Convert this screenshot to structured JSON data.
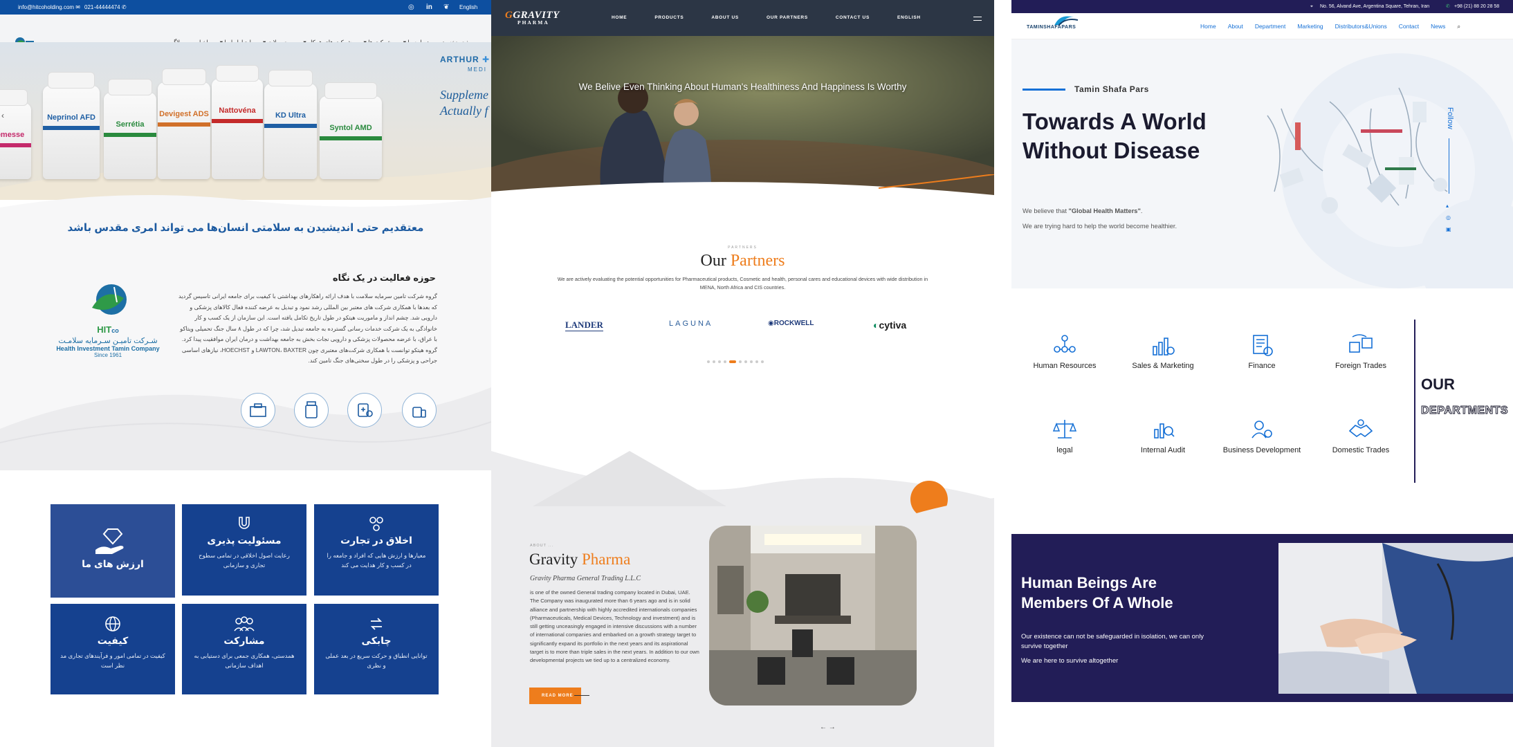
{
  "panel1": {
    "topbar": {
      "email": "info@hitcoholding.com",
      "phone": "021-44444474",
      "lang": "English"
    },
    "nav": [
      "صفحه نخست",
      "درباره ما",
      "شرکت ها",
      "شرکت های همکار",
      "محصولات",
      "ارتباط با ما",
      "اخبار",
      "وبلاگ"
    ],
    "hero": {
      "brand1": "ARTHUR",
      "brand2": "MEDI",
      "tag1": "Suppleme",
      "tag2": "Actually f",
      "bottles": [
        "emesse",
        "Neprinol AFD",
        "Serrétia",
        "Devigest ADS",
        "Nattovéna",
        "KD Ultra",
        "Syntol AMD"
      ]
    },
    "slogan": "معتقدیم حتی اندیشیدن به سلامتی انسان‌ها می تواند امری مقدس باشد",
    "glance_title": "حوزه فعالیت در یک نگاه",
    "glance_text": "گروه شرکت تامین سرمایه سلامت با هدف ارائه راهکارهای بهداشتی با کیفیت برای جامعه ایرانی تاسیس گردید که بعدها با همکاری شرکت های معتبر بین المللی رشد نمود و تبدیل به عرضه کننده فعال کالاهای پزشکی و دارویی شد. چشم انداز و ماموریت هیتکو در طول تاریخ تکامل یافته است. این سازمان از یک کسب و کار خانوادگی به یک شرکت خدمات رسانی گسترده به جامعه تبدیل شد، چرا که در طول ۸ سال جنگ تحمیلی ویتاکو با عراق، با عرضه محصولات پزشکی و دارویی نجات بخش به جامعه بهداشت و درمان ایران موافقیت پیدا کرد. گروه هیتکو توانست با همکاری شرکت‌های معتبری چون LAWTON، BAXTER و HOECHST، نیازهای اساسی جراحی و پزشکی را در طول سختی‌های جنگ تامین کند.",
    "company": {
      "abbr": "HIT",
      "co": "co",
      "fa": "شـرکت تامیـن سـرمایه سلامـت",
      "en": "Health Investment Tamin Company",
      "since": "Since 1961"
    },
    "cards": [
      {
        "title": "ارزش های ما",
        "desc": ""
      },
      {
        "title": "مسئولیت پذیری",
        "desc": "رعایت اصول اخلاقی در تمامی سطوح تجاری و سازمانی"
      },
      {
        "title": "اخلاق در تجارت",
        "desc": "معیارها و ارزش هایی که افراد و جامعه را در کسب و کار هدایت می کند"
      },
      {
        "title": "کیفیت",
        "desc": "کیفیت در تمامی امور و فرآیندهای تجاری مد نظر است"
      },
      {
        "title": "مشارکت",
        "desc": "همدستی، همکاری جمعی برای دستیابی به اهداف سازمانی"
      },
      {
        "title": "چابکی",
        "desc": "توانایی انطباق و حرکت سریع در بعد عملی و نظری"
      }
    ]
  },
  "panel2": {
    "logo": "GRAVITY",
    "logo_sub": "PHARMA",
    "nav": [
      "HOME",
      "PRODUCTS",
      "ABOUT US",
      "OUR PARTNERS",
      "CONTACT US",
      "ENGLISH"
    ],
    "hero_text": "We Belive Even Thinking About Human's Healthiness And Happiness Is Worthy",
    "partners_kicker": "PARTNERS",
    "partners_title_1": "Our",
    "partners_title_2": "Partners",
    "partners_desc": "We are actively evaluating the potential opportunities for Pharmaceutical products, Cosmetic and health, personal cares and educational devices with wide distribution in MENA, North Africa and CIS countries.",
    "partner_logos": [
      "LANDER",
      "LAGUNA",
      "ROCKWELL",
      "cytiva"
    ],
    "about_kicker": "ABOUT",
    "about_title_1": "Gravity",
    "about_title_2": "Pharma",
    "about_sub": "Gravity Pharma General Trading L.L.C",
    "about_text": "is one of the owned General trading company located in Dubai, UAE. The Company was inaugurated more than 6 years ago and is in solid alliance and partnership with highly accredited internationals companies (Pharmaceuticals, Medical Devices, Technology and investment) and is still getting unceasingly engaged in intensive discussions with a number of international companies and embarked on a growth strategy target to significantly expand its portfolio in the next years and its aspirational target is to more than triple sales in the next years. In addition to our own developmental projects we tied up to a centralized economy.",
    "read_more": "READ MORE",
    "pager": "← →"
  },
  "panel3": {
    "top_address": "No. 56, Alvand Ave, Argentina Square, Tehran, Iran",
    "top_phone": "+98 (21) 88 20 28 58",
    "logo": "TAMINSHAFAPARS",
    "nav": [
      "Home",
      "About",
      "Department",
      "Marketing",
      "Distributors&Unions",
      "Contact",
      "News"
    ],
    "kicker": "Tamin Shafa Pars",
    "headline": "Towards A World Without Disease",
    "p1_pre": "We believe that ",
    "p1_bold": "\"Global Health Matters\"",
    "p1_post": ".",
    "p2": "We are trying hard to help the world become healthier.",
    "follow": "Follow",
    "departments": [
      "Human Resources",
      "Sales & Marketing",
      "Finance",
      "Foreign Trades",
      "legal",
      "Internal Audit",
      "Business Development",
      "Domestic Trades"
    ],
    "our": "OUR",
    "departments_label": "DEPARTMENTS",
    "band_title": "Human Beings Are Members Of A Whole",
    "band_p1": "Our existence can not be safeguarded in isolation, we can only survive together",
    "band_p2": "We are here to survive altogether"
  }
}
